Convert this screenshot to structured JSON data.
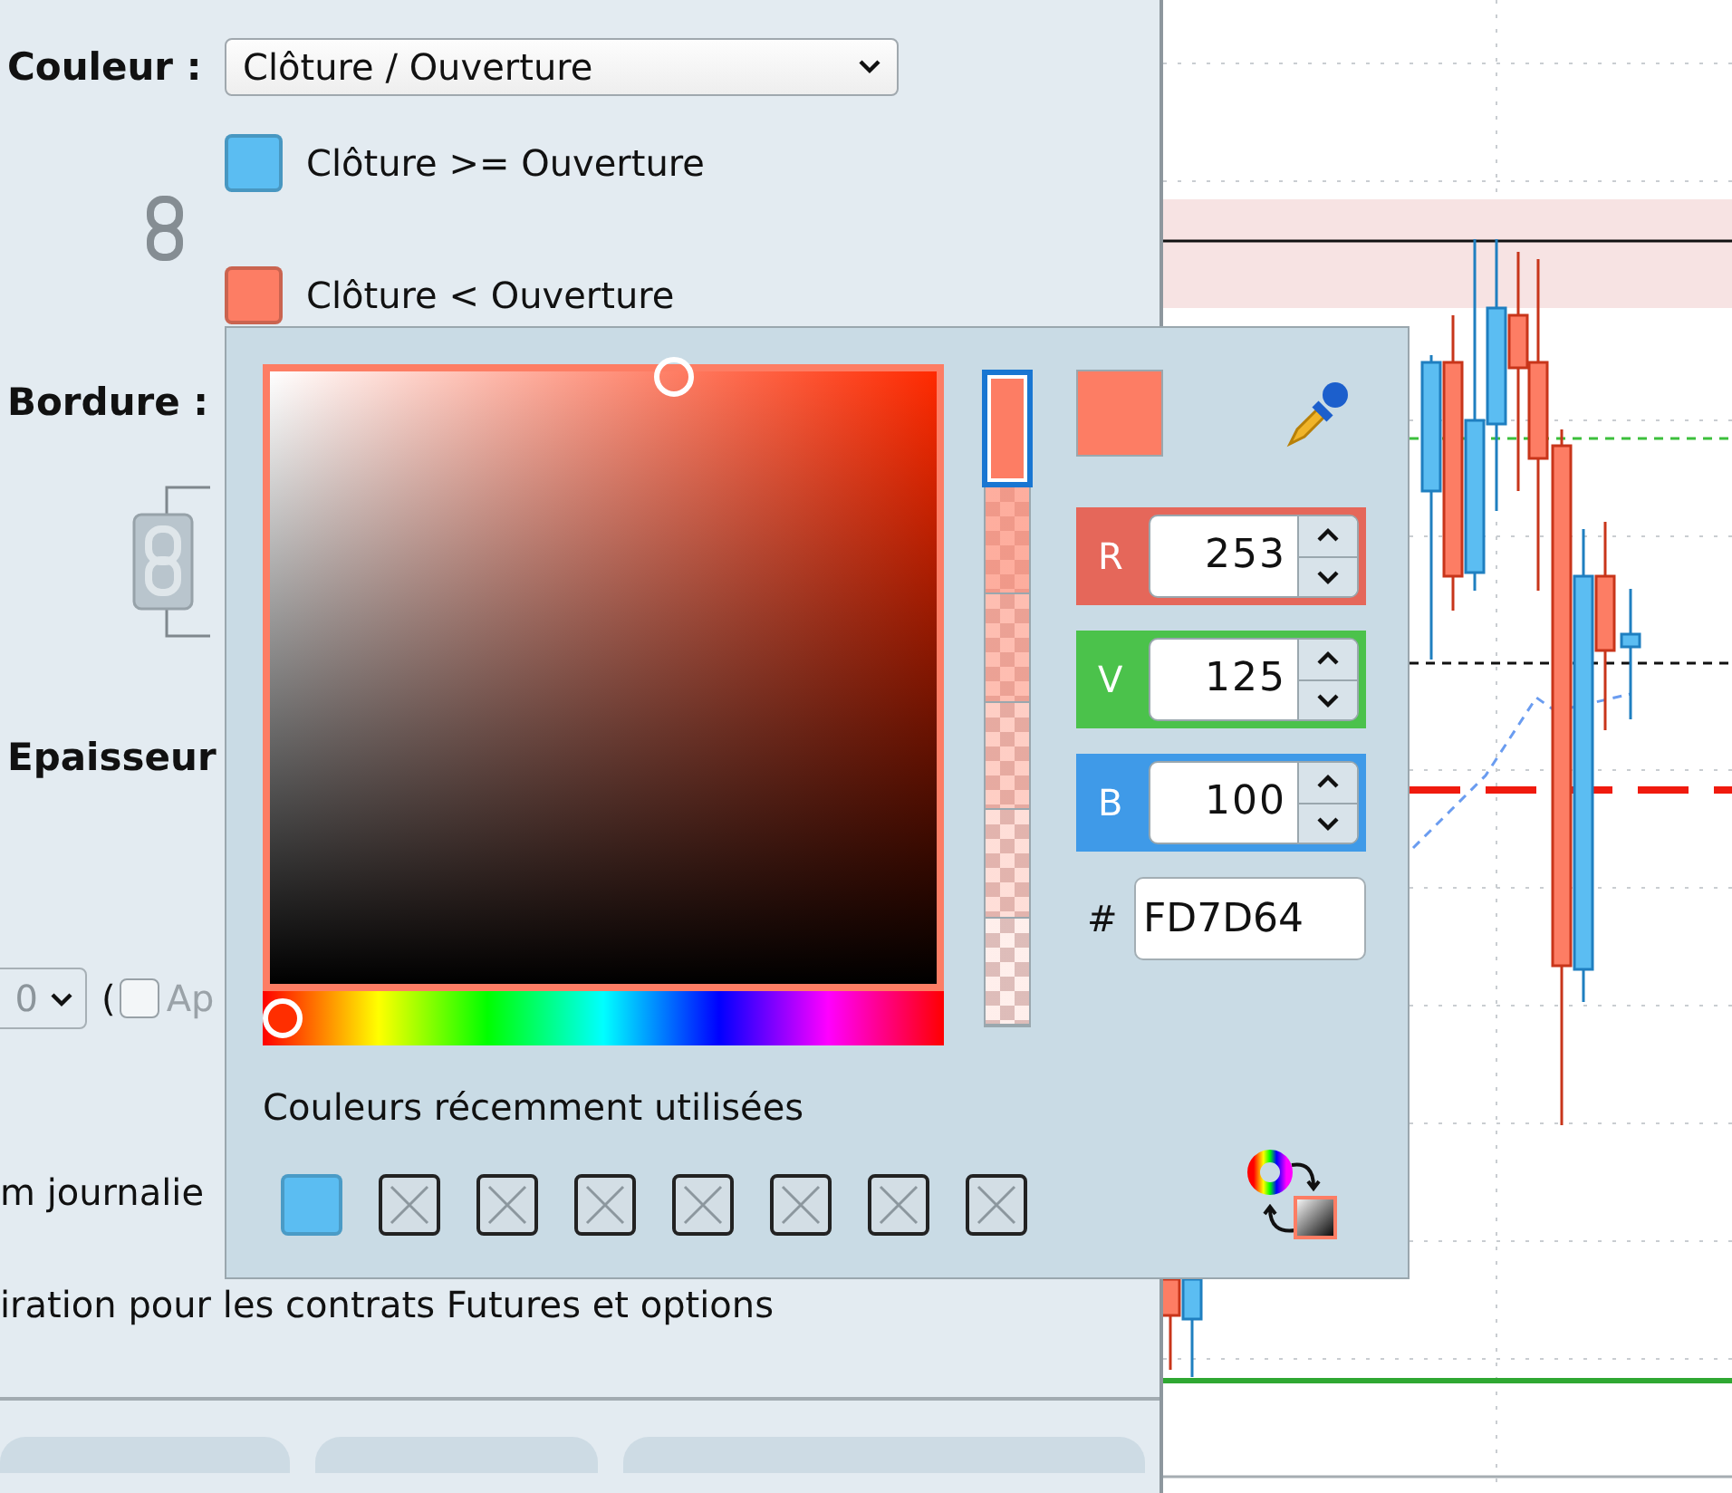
{
  "panel": {
    "color_label": "Couleur :",
    "color_mode": "Clôture / Ouverture",
    "swatches": [
      {
        "label": "Clôture >= Ouverture",
        "color": "#5bbdf2"
      },
      {
        "label": "Clôture < Ouverture",
        "color": "#fd7d64"
      }
    ],
    "border_label": "Bordure :",
    "thickness_label": "Epaisseur",
    "thickness_value": "0",
    "paren": "(",
    "apply_checkbox": {
      "checked": false,
      "label": "Ap"
    },
    "line_1": "m journalie",
    "line_2": "iration pour les contrats Futures et options"
  },
  "color_picker": {
    "hex_label": "#",
    "hex": "FD7D64",
    "channels": [
      {
        "label": "R",
        "value": "253",
        "color": "#e5675a"
      },
      {
        "label": "V",
        "value": "125",
        "color": "#4bc24b"
      },
      {
        "label": "B",
        "value": "100",
        "color": "#3f9ae8"
      }
    ],
    "hue_slider": {
      "level": 0.03
    },
    "alpha_cells": [
      {
        "selected": true
      },
      {
        "selected": false
      },
      {
        "selected": false
      },
      {
        "selected": false
      },
      {
        "selected": false
      },
      {
        "selected": false
      }
    ],
    "recent_title": "Couleurs récemment utilisées",
    "recent": [
      {
        "kind": "color",
        "color": "#5bbdf2"
      },
      {
        "kind": "empty"
      },
      {
        "kind": "empty"
      },
      {
        "kind": "empty"
      },
      {
        "kind": "empty"
      },
      {
        "kind": "empty"
      },
      {
        "kind": "empty"
      },
      {
        "kind": "empty"
      }
    ]
  }
}
